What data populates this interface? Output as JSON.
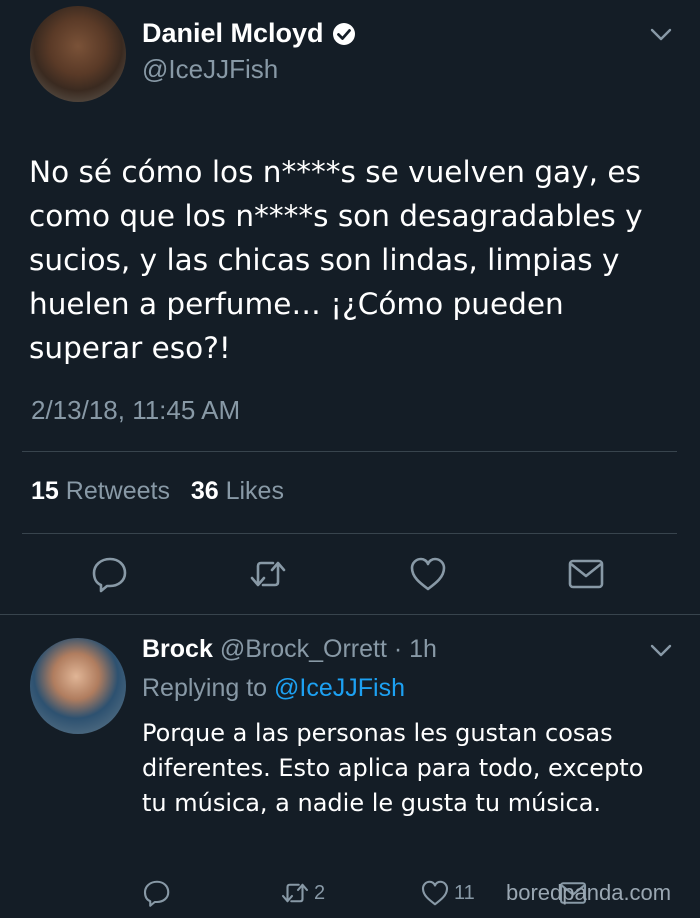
{
  "main_tweet": {
    "author_name": "Daniel Mcloyd",
    "handle": "@IceJJFish",
    "text": "No sé cómo los n****s se vuelven gay, es como que los n****s son desagradables y sucios, y las chicas son lindas, limpias y huelen a perfume… ¡¿Cómo pueden superar eso?!",
    "timestamp": "2/13/18, 11:45 AM",
    "retweet_count": "15",
    "retweet_label": "Retweets",
    "like_count": "36",
    "like_label": "Likes",
    "icons": [
      "reply-icon",
      "retweet-icon",
      "like-icon",
      "message-icon",
      "verified-badge-icon",
      "chevron-down-icon"
    ]
  },
  "reply": {
    "author_name": "Brock",
    "handle": "@Brock_Orrett",
    "time": "· 1h",
    "replying_prefix": "Replying to",
    "replying_to": "@IceJJFish",
    "text": "Porque a las personas les gustan cosas diferentes. Esto aplica para todo, excepto tu música, a nadie le gusta tu música.",
    "retweet_count": "2",
    "like_count": "11"
  },
  "watermark": "boredpanda.com",
  "colors": {
    "background": "#141d26",
    "secondary_text": "#8899a6",
    "link": "#1da1f2",
    "divider": "#38444d"
  }
}
